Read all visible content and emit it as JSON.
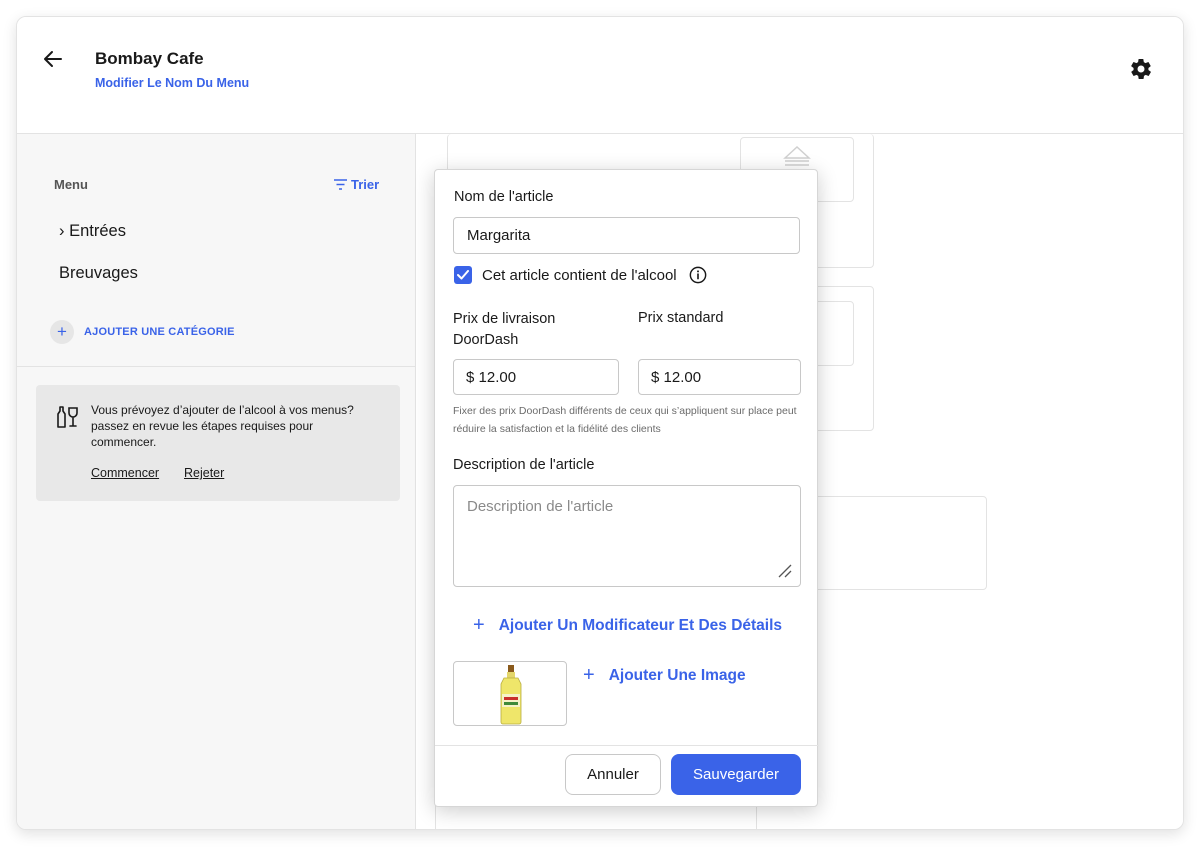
{
  "header": {
    "title": "Bombay Cafe",
    "subtitle": "Modifier Le Nom Du Menu",
    "back_icon": "arrow-left-icon",
    "settings_icon": "gear-icon"
  },
  "sidebar": {
    "menu_label": "Menu",
    "sort_label": "Trier",
    "categories": [
      {
        "label": "› Entrées"
      },
      {
        "label": "Breuvages"
      }
    ],
    "add_category_label": "AJOUTER UNE CATÉGORIE",
    "alcohol_notice": {
      "text": "Vous prévoyez d’ajouter de l’alcool à vos menus? passez en revue les étapes requises pour commencer.",
      "start_link": "Commencer",
      "reject_link": "Rejeter"
    }
  },
  "modal": {
    "item_name_label": "Nom de l'article",
    "item_name_value": "Margarita",
    "alcohol_checkbox_label": "Cet article contient de l'alcool",
    "alcohol_checked": true,
    "delivery_price_label_line1": "Prix de livraison",
    "delivery_price_label_line2": "DoorDash",
    "standard_price_label": "Prix standard",
    "delivery_price_value": "$ 12.00",
    "standard_price_value": "$ 12.00",
    "price_hint": "Fixer des prix DoorDash différents de ceux qui s’appliquent sur place peut réduire la satisfaction et la fidélité des clients",
    "description_label": "Description de l'article",
    "description_placeholder": "Description de l'article",
    "add_modifier_label": "Ajouter Un Modificateur Et Des Détails",
    "add_image_label": "Ajouter Une Image",
    "cancel_label": "Annuler",
    "save_label": "Sauvegarder"
  },
  "colors": {
    "accent": "#3a63e8",
    "sidebar_bg": "#f7f7f7",
    "notice_bg": "#e8e8e8"
  }
}
